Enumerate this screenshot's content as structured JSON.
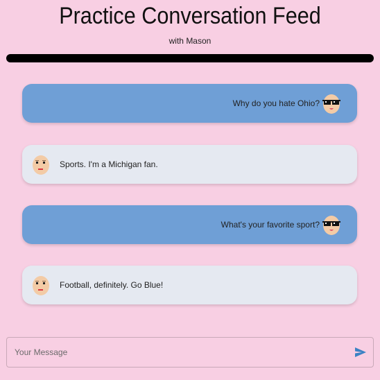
{
  "header": {
    "title": "Practice Conversation Feed",
    "subtitle": "with Mason"
  },
  "messages": [
    {
      "sender": "user",
      "text": "Why do you hate Ohio?",
      "avatar": "sunglasses-face-icon"
    },
    {
      "sender": "bot",
      "text": "Sports. I'm a Michigan fan.",
      "avatar": "bald-man-face-icon"
    },
    {
      "sender": "user",
      "text": "What's your favorite sport?",
      "avatar": "sunglasses-face-icon"
    },
    {
      "sender": "bot",
      "text": "Football, definitely. Go Blue!",
      "avatar": "bald-man-face-icon"
    }
  ],
  "composer": {
    "placeholder": "Your Message",
    "value": "",
    "send_icon": "send-icon"
  },
  "colors": {
    "background": "#f8cfe3",
    "user_bubble": "#6f9fd6",
    "bot_bubble": "#e5e9f1",
    "send_icon": "#3b82c4"
  }
}
